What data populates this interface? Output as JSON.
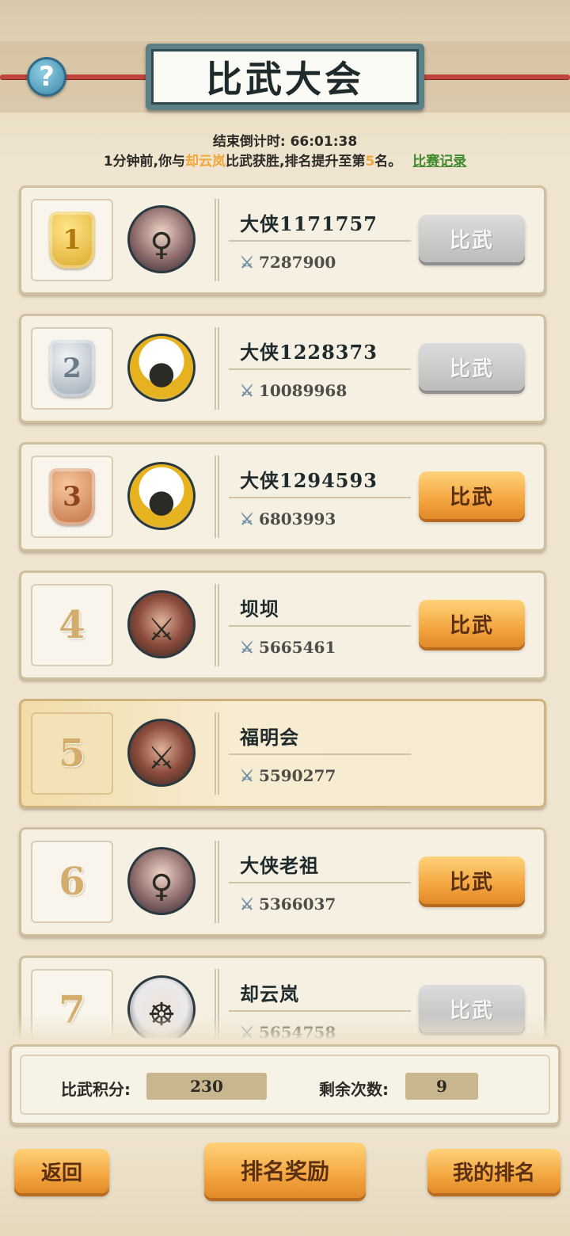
{
  "header": {
    "title": "比武大会",
    "help_icon": "?",
    "countdown_label": "结束倒计时:",
    "countdown_value": "66:01:38",
    "notice_prefix": "1分钟前,你与",
    "notice_opponent": "却云岚",
    "notice_mid": "比武获胜,排名提升至第",
    "notice_rank": "5",
    "notice_suffix": "名。",
    "record_link": "比赛记录"
  },
  "fight_label": "比武",
  "rows": [
    {
      "rank": "1",
      "medal": "gold",
      "avatar": "female",
      "name": "大侠1171757",
      "power": "7287900",
      "button": "disabled"
    },
    {
      "rank": "2",
      "medal": "silver",
      "avatar": "panda",
      "name": "大侠1228373",
      "power": "10089968",
      "button": "disabled"
    },
    {
      "rank": "3",
      "medal": "bronze",
      "avatar": "panda",
      "name": "大侠1294593",
      "power": "6803993",
      "button": "active"
    },
    {
      "rank": "4",
      "medal": "none",
      "avatar": "warrior",
      "name": "坝坝",
      "power": "5665461",
      "button": "active"
    },
    {
      "rank": "5",
      "medal": "none",
      "avatar": "warrior",
      "name": "福明会",
      "power": "5590277",
      "button": "none",
      "self": true
    },
    {
      "rank": "6",
      "medal": "none",
      "avatar": "female",
      "name": "大侠老祖",
      "power": "5366037",
      "button": "active"
    },
    {
      "rank": "7",
      "medal": "none",
      "avatar": "scholar",
      "name": "却云岚",
      "power": "5654758",
      "button": "disabled"
    }
  ],
  "stats": {
    "points_label": "比武积分:",
    "points_value": "230",
    "remaining_label": "剩余次数:",
    "remaining_value": "9"
  },
  "footer": {
    "back_label": "返回",
    "rewards_label": "排名奖励",
    "my_rank_label": "我的排名"
  }
}
